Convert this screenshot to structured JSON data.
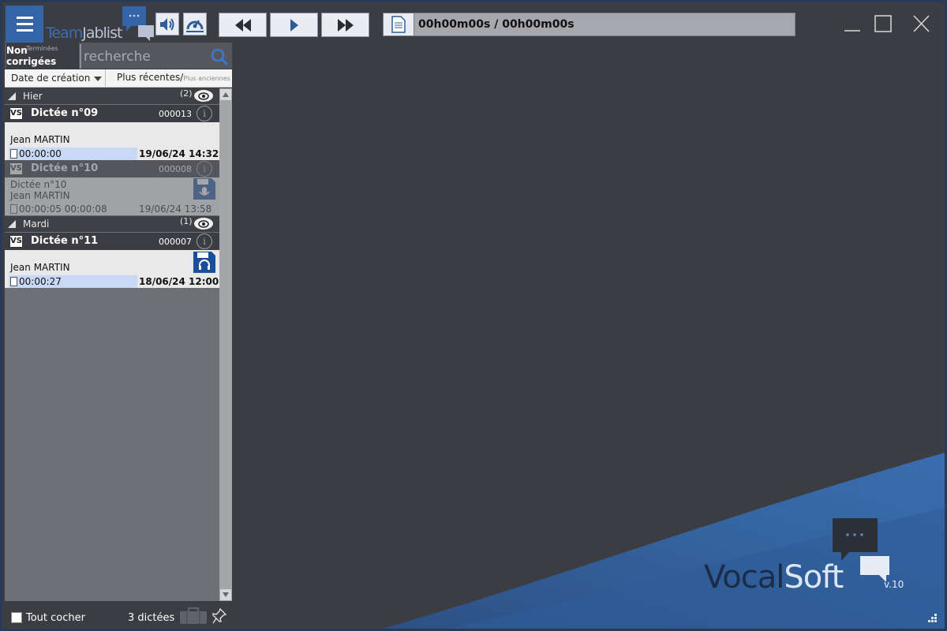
{
  "app": {
    "logo_team": "Team",
    "logo_jab": "Jablist",
    "brand_vocal": "Vocal",
    "brand_soft": "Soft",
    "version": "v.10"
  },
  "toolbar": {
    "menu_icon": "hamburger-icon",
    "volume_icon": "speaker-icon",
    "speed_icon": "speed-gauge-icon",
    "rewind_icon": "rewind-icon",
    "play_icon": "play-icon",
    "forward_icon": "fast-forward-icon",
    "time_display": "00h00m00s / 00h00m00s"
  },
  "window": {
    "minimize_icon": "minimize-icon",
    "maximize_icon": "maximize-icon",
    "close_icon": "close-icon"
  },
  "filters": {
    "tab_active": "Non corrigées",
    "tab_inactive": "Terminées",
    "search_placeholder": "recherche",
    "sort_field": "Date de création",
    "sort_order": "Plus récentes/",
    "sort_order_alt": "Plus anciennes"
  },
  "groups": [
    {
      "label": "Hier",
      "count": "(2)"
    },
    {
      "label": "Mardi",
      "count": "(1)"
    }
  ],
  "dictations": [
    {
      "title": "Dictée n°09",
      "number": "000013",
      "subtitle": "",
      "author": "Jean MARTIN",
      "duration": "00:00:00",
      "duration_extra": "",
      "date": "19/06/24 14:32",
      "status_icon": ""
    },
    {
      "title": "Dictée n°10",
      "number": "000008",
      "subtitle": "Dictée n°10",
      "author": "Jean MARTIN",
      "duration": "00:00:05",
      "duration_extra": "00:00:08",
      "date": "19/06/24 13:58",
      "status_icon": "save-mic-icon"
    },
    {
      "title": "Dictée n°11",
      "number": "000007",
      "subtitle": "",
      "author": "Jean MARTIN",
      "duration": "00:00:27",
      "duration_extra": "",
      "date": "18/06/24 12:00",
      "status_icon": "save-headset-icon"
    }
  ],
  "footer": {
    "check_all_label": "Tout cocher",
    "count_label": "3 dictées"
  },
  "colors": {
    "accent": "#3565a8",
    "background": "#3b3d43",
    "highlight": "#c9d9f5"
  }
}
